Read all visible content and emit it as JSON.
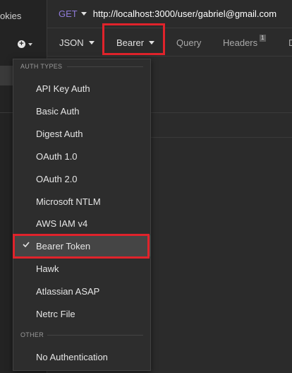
{
  "sidebar": {
    "cookies_label": "okies",
    "add_icon": "plus-circle-icon"
  },
  "request": {
    "method": "GET",
    "url": "http://localhost:3000/user/gabriel@gmail.com"
  },
  "tabs": [
    {
      "label": "JSON"
    },
    {
      "label": "Bearer"
    },
    {
      "label": "Query"
    },
    {
      "label": "Headers",
      "badge": "1"
    },
    {
      "label": "D"
    }
  ],
  "auth_menu": {
    "section_auth_types": "AUTH TYPES",
    "items": [
      {
        "label": "API Key Auth"
      },
      {
        "label": "Basic Auth"
      },
      {
        "label": "Digest Auth"
      },
      {
        "label": "OAuth 1.0"
      },
      {
        "label": "OAuth 2.0"
      },
      {
        "label": "Microsoft NTLM"
      },
      {
        "label": "AWS IAM v4"
      },
      {
        "label": "Bearer Token",
        "selected": true
      },
      {
        "label": "Hawk"
      },
      {
        "label": "Atlassian ASAP"
      },
      {
        "label": "Netrc File"
      }
    ],
    "section_other": "OTHER",
    "other_items": [
      {
        "label": "No Authentication"
      }
    ]
  },
  "colors": {
    "highlight": "#e0232b",
    "method": "#8f7bd9",
    "background": "#2b2b2b"
  }
}
